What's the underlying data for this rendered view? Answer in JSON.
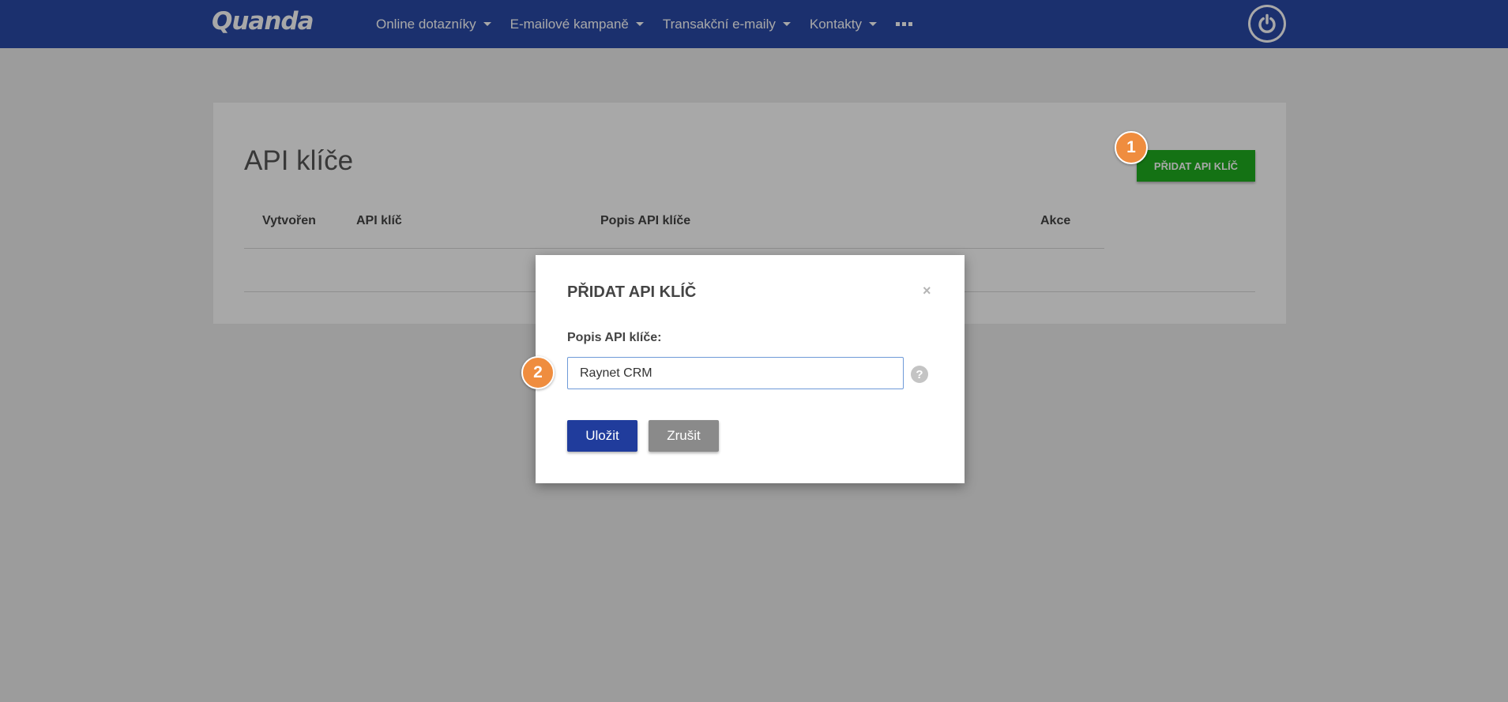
{
  "header": {
    "logo": "Quanda",
    "menu": [
      {
        "label": "Online dotazníky"
      },
      {
        "label": "E-mailové kampaně"
      },
      {
        "label": "Transakční e-maily"
      },
      {
        "label": "Kontakty"
      }
    ],
    "more_icon": "more-icon",
    "power_icon": "power-icon"
  },
  "page": {
    "title": "API klíče",
    "add_button_label": "PŘIDAT API KLÍČ",
    "table": {
      "columns": [
        "Vytvořen",
        "API klíč",
        "Popis API klíče",
        "Akce"
      ]
    }
  },
  "badges": [
    "1",
    "2"
  ],
  "modal": {
    "title": "PŘIDAT API KLÍČ",
    "close": "×",
    "field_label": "Popis API klíče:",
    "field_value": "Raynet CRM",
    "help": "?",
    "save_label": "Uložit",
    "cancel_label": "Zrušit"
  },
  "colors": {
    "navbar": "#2a4aa8",
    "add_button": "#1fad1f",
    "save_button": "#203c9c",
    "cancel_button": "#8a8a8a",
    "badge": "#ef8d3f"
  }
}
